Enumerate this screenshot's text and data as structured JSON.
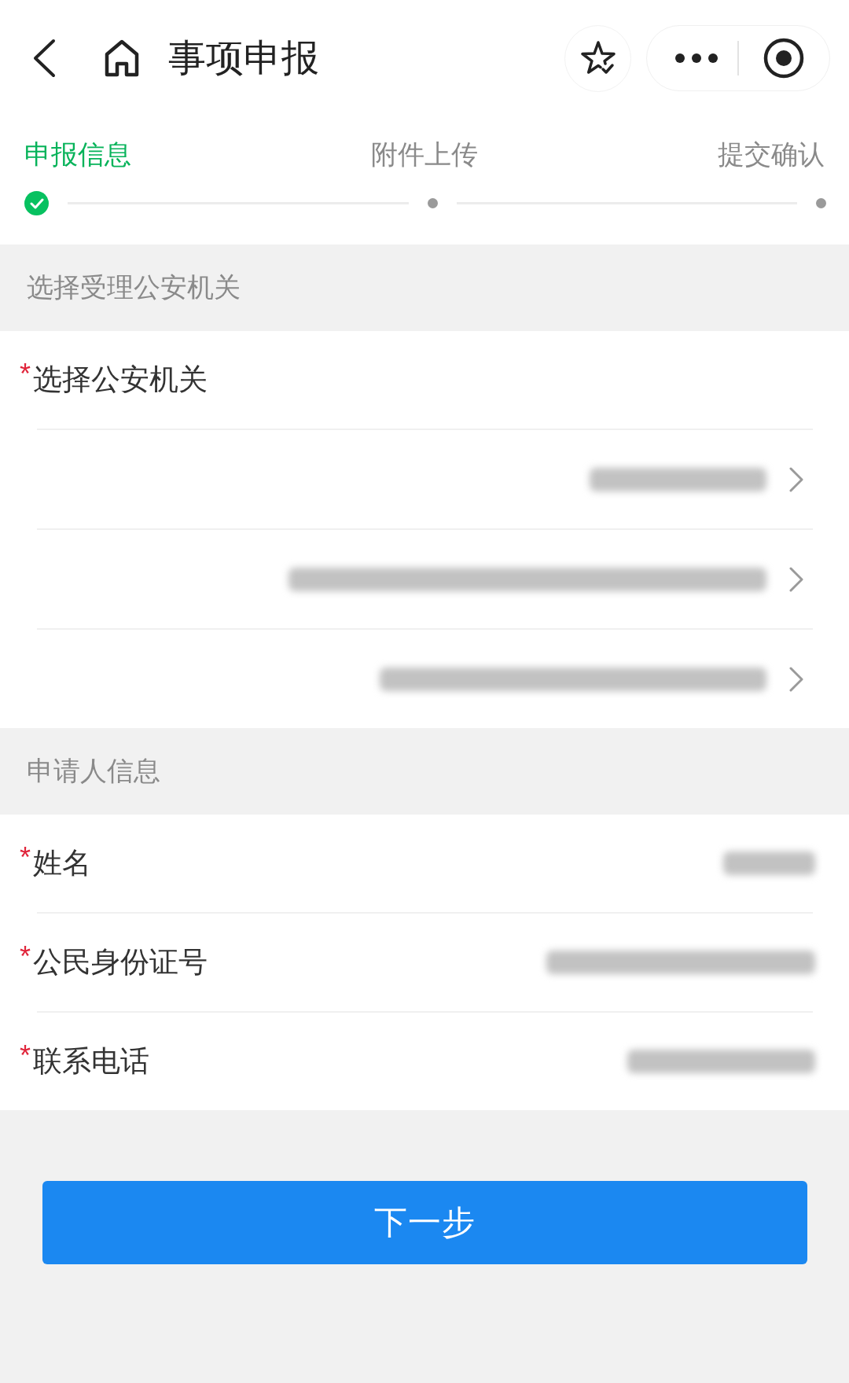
{
  "header": {
    "title": "事项申报"
  },
  "steps": [
    {
      "label": "申报信息",
      "selected": true,
      "completed": true
    },
    {
      "label": "附件上传",
      "selected": false,
      "completed": false
    },
    {
      "label": "提交确认",
      "selected": false,
      "completed": false
    }
  ],
  "sections": [
    {
      "title": "选择受理公安机关",
      "fields": [
        {
          "kind": "heading",
          "label": "选择公安机关",
          "required_mark": "*"
        },
        {
          "kind": "select",
          "redacted": true
        },
        {
          "kind": "select",
          "redacted": true
        },
        {
          "kind": "select",
          "redacted": true
        }
      ]
    },
    {
      "title": "申请人信息",
      "fields": [
        {
          "kind": "text",
          "label": "姓名",
          "required_mark": "*",
          "redacted": true
        },
        {
          "kind": "text",
          "label": "公民身份证号",
          "required_mark": "*",
          "redacted": true
        },
        {
          "kind": "text",
          "label": "联系电话",
          "required_mark": "*",
          "redacted": true
        }
      ]
    }
  ],
  "next_button": {
    "label": "下一步"
  }
}
